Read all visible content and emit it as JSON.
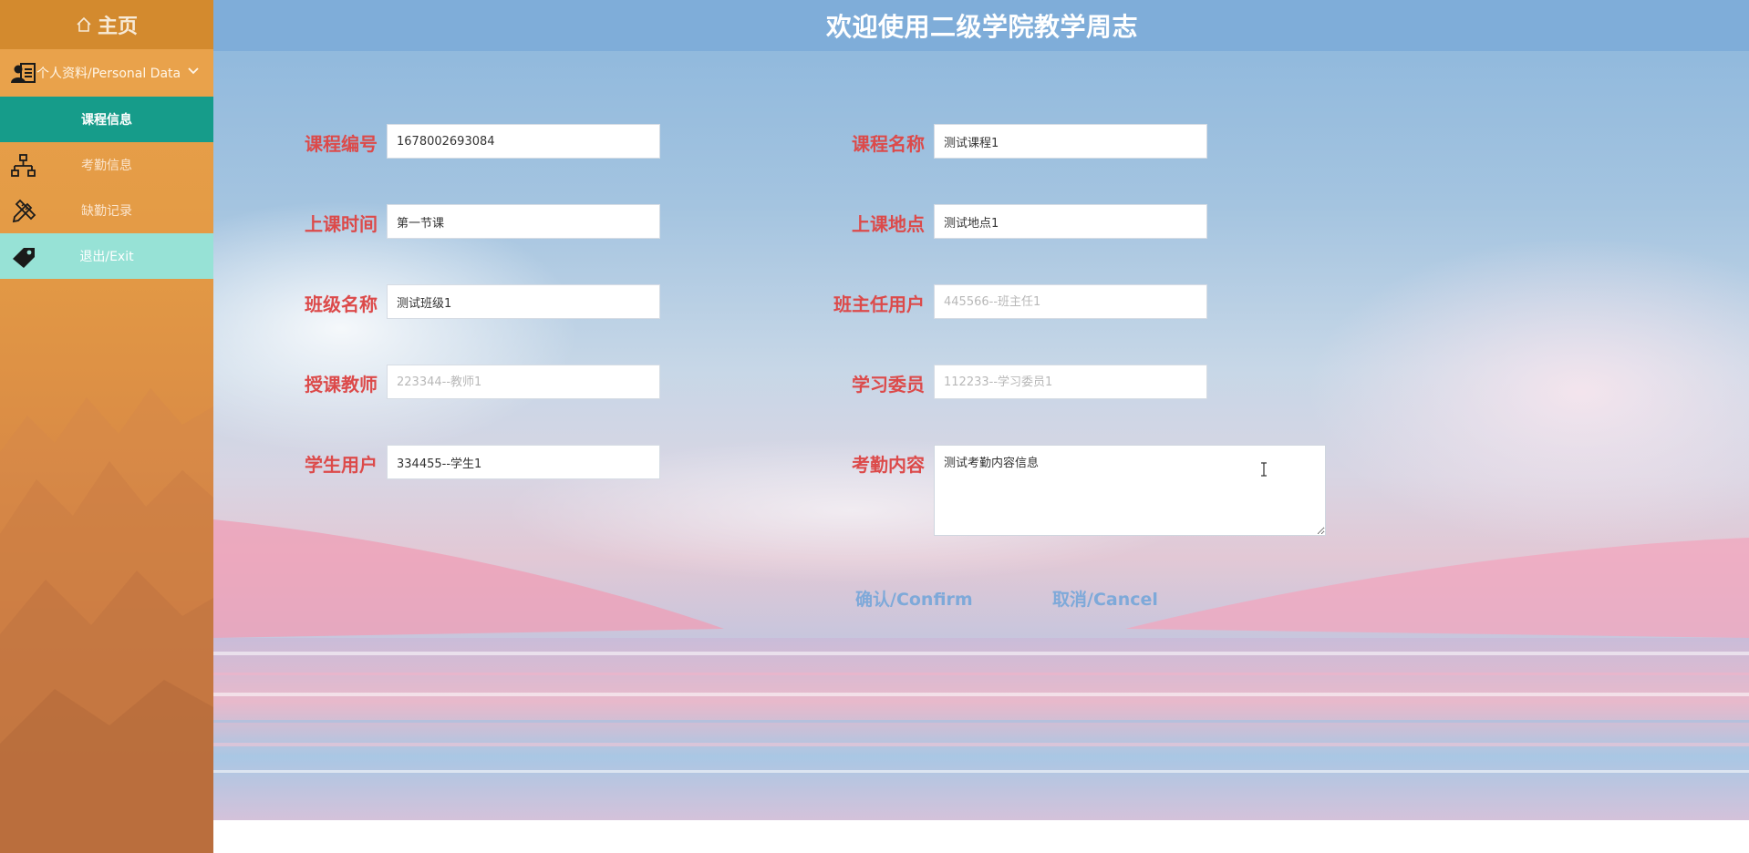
{
  "sidebar": {
    "home_label": "主页",
    "items": [
      {
        "label": "个人资料/Personal Data",
        "icon": "profile-card-icon"
      },
      {
        "label": "课程信息",
        "icon": ""
      },
      {
        "label": "考勤信息",
        "icon": "org-chart-icon"
      },
      {
        "label": "缺勤记录",
        "icon": "pencil-ruler-icon"
      },
      {
        "label": "退出/Exit",
        "icon": "tag-icon"
      }
    ]
  },
  "header": {
    "title": "欢迎使用二级学院教学周志"
  },
  "form": {
    "course_no": {
      "label": "课程编号",
      "value": "1678002693084"
    },
    "course_name": {
      "label": "课程名称",
      "value": "测试课程1"
    },
    "class_time": {
      "label": "上课时间",
      "value": "第一节课"
    },
    "class_place": {
      "label": "上课地点",
      "value": "测试地点1"
    },
    "class_name": {
      "label": "班级名称",
      "value": "测试班级1"
    },
    "head_teacher": {
      "label": "班主任用户",
      "placeholder": "445566--班主任1"
    },
    "teacher": {
      "label": "授课教师",
      "placeholder": "223344--教师1"
    },
    "study_rep": {
      "label": "学习委员",
      "placeholder": "112233--学习委员1"
    },
    "student": {
      "label": "学生用户",
      "value": "334455--学生1"
    },
    "attendance": {
      "label": "考勤内容",
      "value": "测试考勤内容信息"
    }
  },
  "actions": {
    "confirm_label": "确认/Confirm",
    "cancel_label": "取消/Cancel"
  },
  "colors": {
    "sidebar_bg": "#e39a45",
    "home_bg": "#d38a2e",
    "active_item": "#169c8a",
    "exit_item": "#97e2d6",
    "topbar": "#7fadd9",
    "label_red": "#dc4a4a",
    "button_blue": "#7ea9d9"
  }
}
